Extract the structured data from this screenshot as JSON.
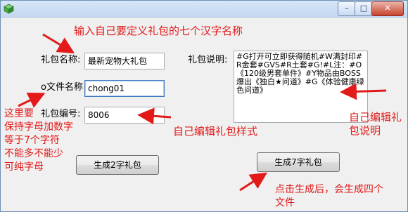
{
  "window": {
    "close_glyph": "✕",
    "maximize_glyph": "□",
    "minimize_glyph": "–"
  },
  "form": {
    "pack_name": {
      "label": "礼包名称:",
      "value": "最新宠物大礼包"
    },
    "file_name": {
      "label": "o文件名称",
      "value": "chong01"
    },
    "pack_id": {
      "label": "礼包编号:",
      "value": "8006"
    },
    "description": {
      "label": "礼包说明:",
      "value": "#G打开可立即获得随机#W满封印#R金套#GVS#R土套#G!#L注：#O《120级男套单件》#Y物品由BOSS爆出《独白★问道》#G《体验健康绿色问道》"
    }
  },
  "buttons": {
    "gen2": "生成2字礼包",
    "gen7": "生成7字礼包"
  },
  "annotations": {
    "top": "输入自己要定义礼包的七个汉字名称",
    "left": [
      "这里要",
      "保持字母加数字",
      "等于7个字符",
      "不能多不能少",
      "可纯字母"
    ],
    "middle": "自己编辑礼包样式",
    "right": [
      "自己编辑礼",
      "包说明"
    ],
    "bottom": [
      "点击生成后，会生成四个",
      "文件"
    ]
  },
  "colors": {
    "annotation": "#e21a1a"
  },
  "icons": {
    "app": "cube-icon"
  }
}
